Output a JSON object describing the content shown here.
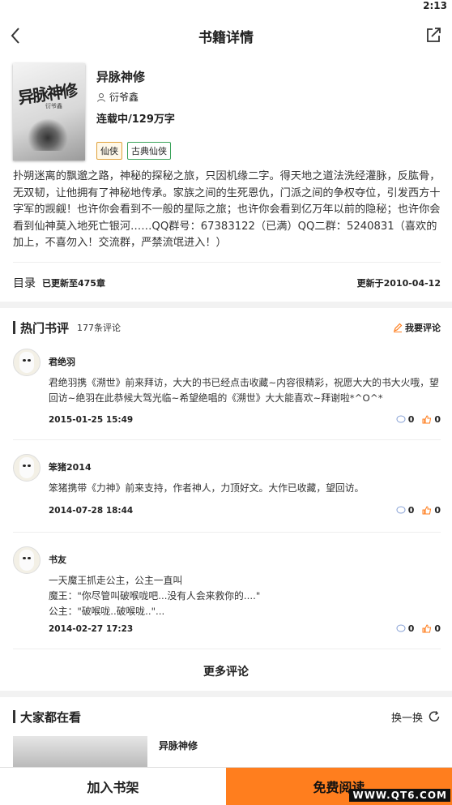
{
  "status_bar": {
    "time": "2:13"
  },
  "header": {
    "title": "书籍详情"
  },
  "book": {
    "cover_title": "异脉神修",
    "cover_author": "衍爷鑫",
    "name": "异脉神修",
    "author": "衍爷鑫",
    "status": "连载中/129万字",
    "tags": [
      "仙侠",
      "古典仙侠"
    ],
    "intro": "扑朔迷离的飘邈之路，神秘的探秘之旅，只因机缘二字。得天地之道法洗经灌脉，反肱骨，无双韧，让他拥有了神秘地传承。家族之间的生死恩仇，门派之间的争权夺位，引发西方十字军的觊觎！也许你会看到不一般的星际之旅；也许你会看到亿万年以前的隐秘；也许你会看到仙神莫入地死亡银河……QQ群号：67383122（已满）QQ二群：5240831（喜欢的加上，不喜勿入！交流群，严禁流氓进入！）"
  },
  "toc": {
    "label": "目录",
    "count": "已更新至475章",
    "updated": "更新于2010-04-12"
  },
  "reviews": {
    "title": "热门书评",
    "count": "177条评论",
    "write_label": "我要评论",
    "items": [
      {
        "name": "君绝羽",
        "text": "君绝羽携《溯世》前来拜访，大大的书已经点击收藏~内容很精彩，祝愿大大的书大火哦，望回访~绝羽在此恭候大驾光临~希望绝唱的《溯世》大大能喜欢~拜谢啦*^O^*",
        "date": "2015-01-25 15:49",
        "replies": "0",
        "likes": "0"
      },
      {
        "name": "笨猪2014",
        "text": "笨猪携带《力神》前来支持，作者神人，力顶好文。大作已收藏，望回访。",
        "date": "2014-07-28 18:44",
        "replies": "0",
        "likes": "0"
      },
      {
        "name": "书友",
        "text": "一天魔王抓走公主，公主一直叫\n魔王：\"你尽管叫破喉咙吧...没有人会来救你的....\"\n公主：\"破喉咙..破喉咙..\"...",
        "date": "2014-02-27 17:23",
        "replies": "0",
        "likes": "0"
      }
    ],
    "more_label": "更多评论"
  },
  "popular": {
    "title": "大家都在看",
    "refresh_label": "换一换",
    "items": [
      {
        "title": "异脉神修"
      }
    ]
  },
  "bottom": {
    "add_shelf": "加入书架",
    "read_free": "免费阅读",
    "watermark": "WWW.QT6.COM"
  },
  "colors": {
    "accent": "#ff7e1e",
    "tag_xianxia": "#e0a23a",
    "tag_classic": "#3aa35a",
    "reply_icon": "#8aa3d6",
    "like_icon": "#ff7e1e"
  },
  "icons": [
    "back-icon",
    "share-icon",
    "user-icon",
    "edit-icon",
    "comment-icon",
    "like-icon",
    "refresh-icon"
  ]
}
